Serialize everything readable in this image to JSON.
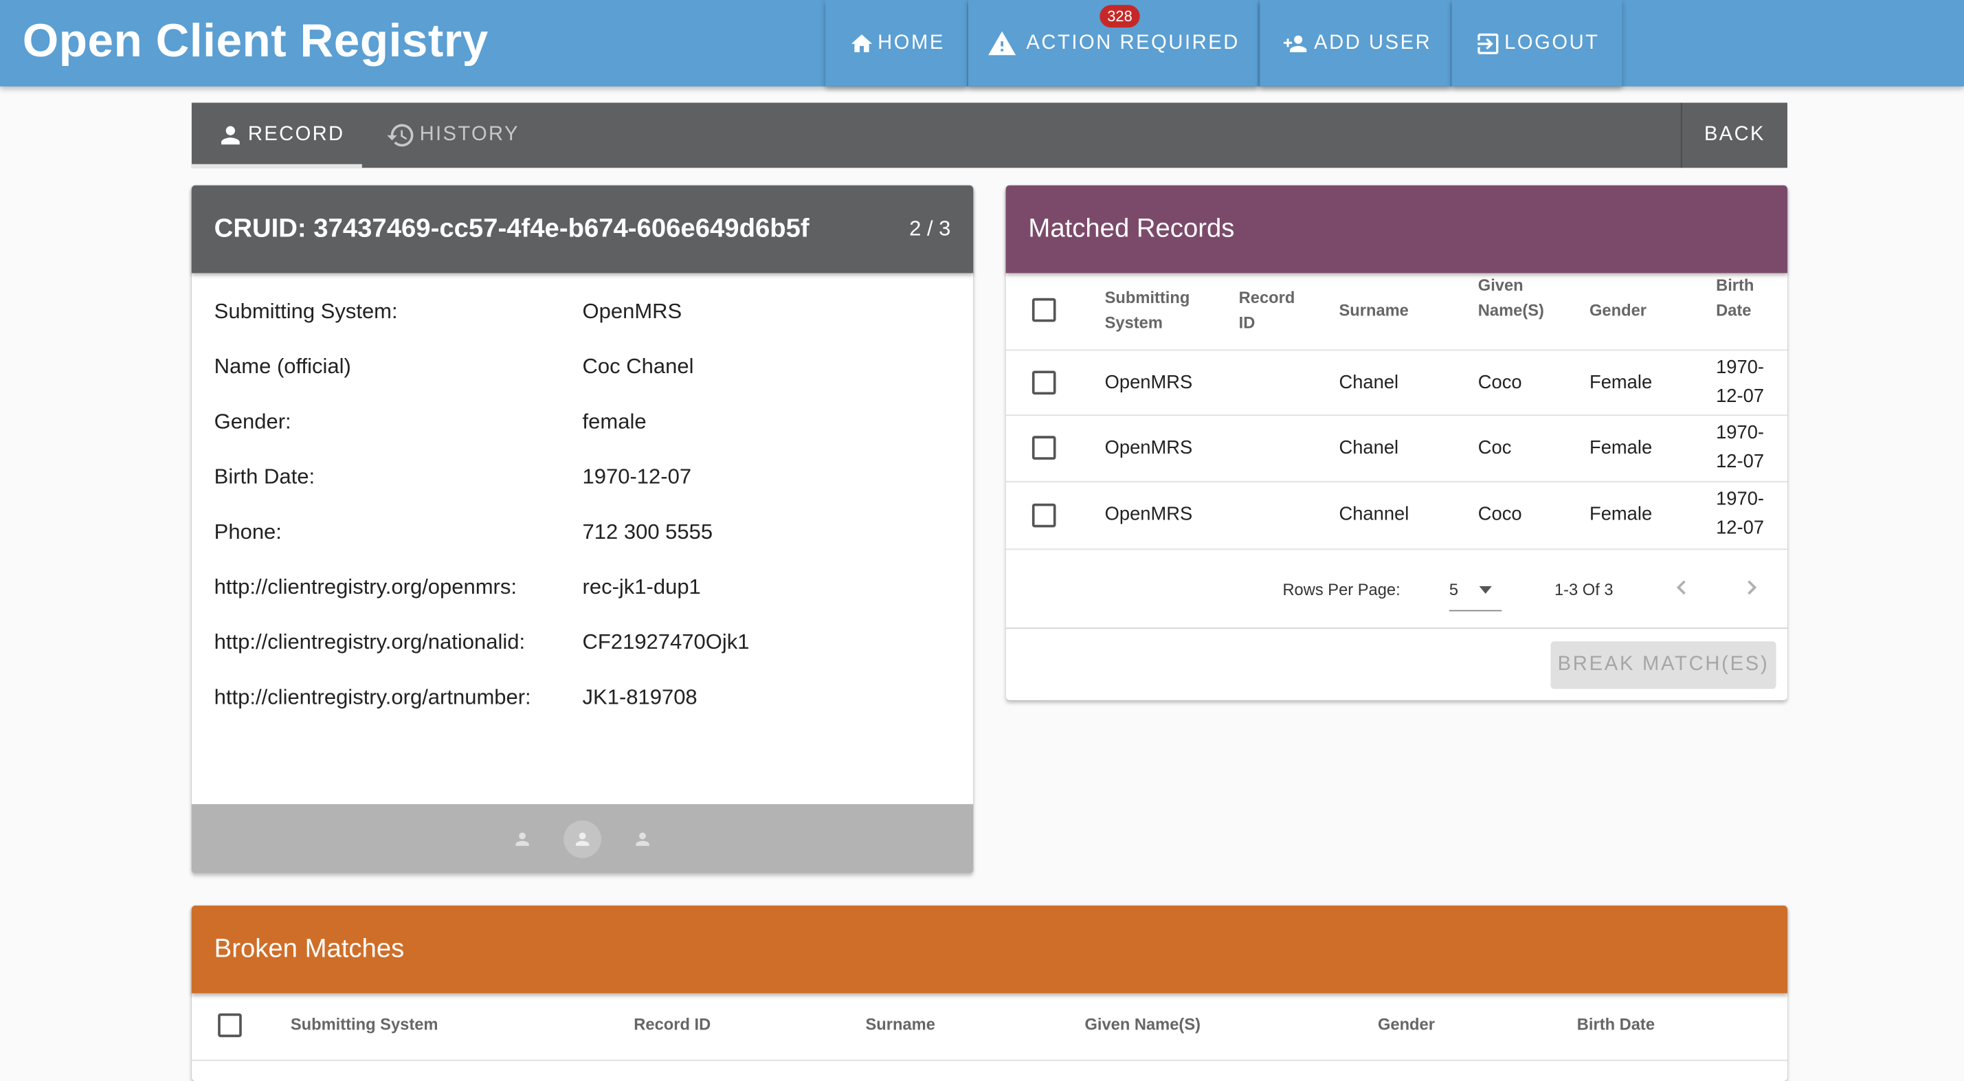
{
  "appbar": {
    "title": "Open Client Registry",
    "nav": {
      "home": "HOME",
      "action_required": "ACTION REQUIRED",
      "action_count": "328",
      "add_user": "ADD USER",
      "logout": "LOGOUT"
    }
  },
  "tabs": {
    "record": "RECORD",
    "history": "HISTORY",
    "back": "BACK"
  },
  "record": {
    "cruid": "CRUID: 37437469-cc57-4f4e-b674-606e649d6b5f",
    "pager": "2 / 3",
    "fields": [
      {
        "label": "Submitting System:",
        "value": "OpenMRS"
      },
      {
        "label": "Name (official)",
        "value": "Coc Chanel"
      },
      {
        "label": "Gender:",
        "value": "female"
      },
      {
        "label": "Birth Date:",
        "value": "1970-12-07"
      },
      {
        "label": "Phone:",
        "value": "712 300 5555"
      },
      {
        "label": "http://clientregistry.org/openmrs:",
        "value": "rec-jk1-dup1"
      },
      {
        "label": "http://clientregistry.org/nationalid:",
        "value": "CF21927470Ojk1"
      },
      {
        "label": "http://clientregistry.org/artnumber:",
        "value": "JK1-819708"
      }
    ],
    "active_page": 2
  },
  "matched": {
    "title": "Matched Records",
    "columns": {
      "system_1": "Submitting",
      "system_2": "System",
      "record_1": "Record",
      "record_2": "ID",
      "surname": "Surname",
      "given_1": "Given",
      "given_2": "Name(S)",
      "gender": "Gender",
      "birth_1": "Birth",
      "birth_2": "Date"
    },
    "rows": [
      {
        "system": "OpenMRS",
        "record_id": "",
        "surname": "Chanel",
        "given": "Coco",
        "gender": "Female",
        "birth_1": "1970-",
        "birth_2": "12-07"
      },
      {
        "system": "OpenMRS",
        "record_id": "",
        "surname": "Chanel",
        "given": "Coc",
        "gender": "Female",
        "birth_1": "1970-",
        "birth_2": "12-07"
      },
      {
        "system": "OpenMRS",
        "record_id": "",
        "surname": "Channel",
        "given": "Coco",
        "gender": "Female",
        "birth_1": "1970-",
        "birth_2": "12-07"
      }
    ],
    "rows_per_page_label": "Rows Per Page:",
    "rows_per_page": "5",
    "range": "1-3 Of 3",
    "break_button": "BREAK MATCH(ES)"
  },
  "broken": {
    "title": "Broken Matches",
    "columns": {
      "system": "Submitting System",
      "record_id": "Record ID",
      "surname": "Surname",
      "given": "Given Name(S)",
      "gender": "Gender",
      "birth": "Birth Date"
    }
  }
}
